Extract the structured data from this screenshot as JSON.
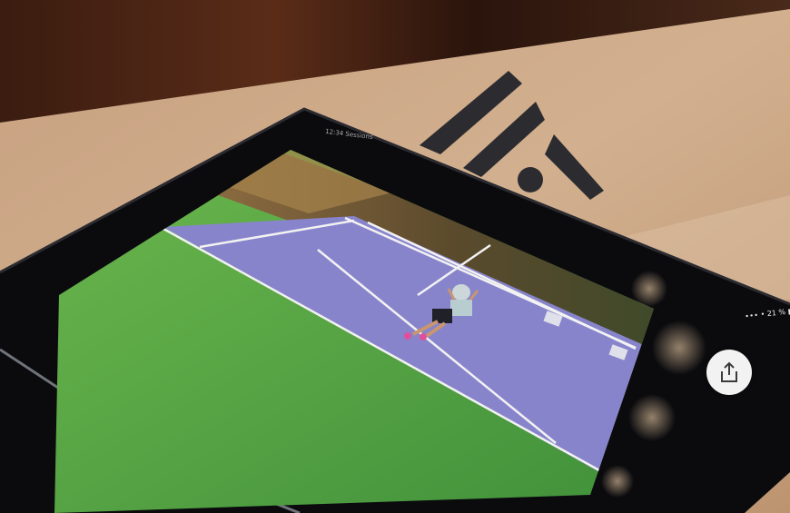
{
  "scene": {
    "description_type": "photo",
    "subject": "tablet-on-cardboard-box",
    "colors": {
      "background_wood": "#4a2414",
      "cardboard": "#c9a07c",
      "tablet_frame": "#0b0b0e",
      "court_surface": "#8a86cf",
      "court_surround": "#5fa84a",
      "logo": "#2a2a2e"
    }
  },
  "tablet": {
    "status_bar": {
      "signal_wifi_battery": "∙∙∙ • 21 % ▮"
    },
    "timestamp_text": "12:34  Sessions",
    "share_button": {
      "icon": "share-icon"
    }
  }
}
